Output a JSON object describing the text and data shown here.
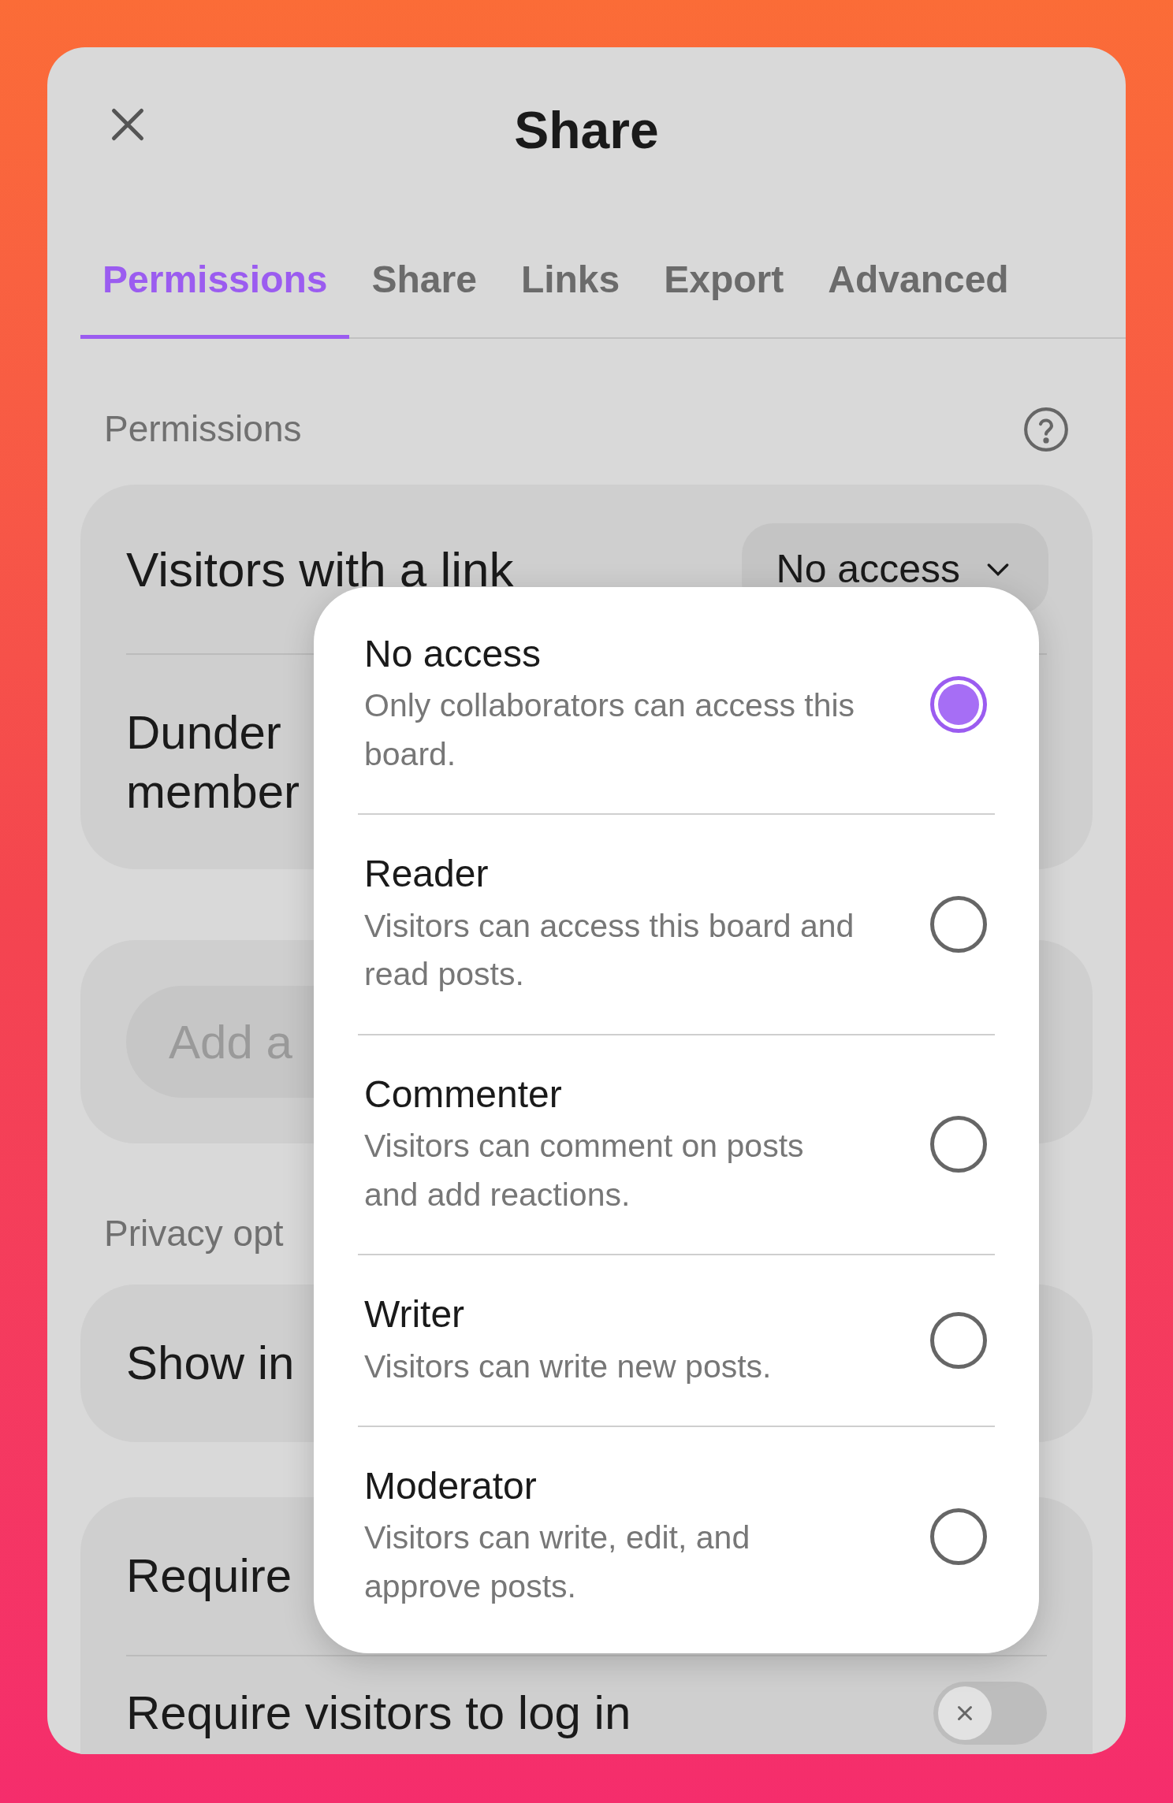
{
  "dialog": {
    "title": "Share"
  },
  "tabs": [
    {
      "label": "Permissions",
      "selected": true
    },
    {
      "label": "Share",
      "selected": false
    },
    {
      "label": "Links",
      "selected": false
    },
    {
      "label": "Export",
      "selected": false
    },
    {
      "label": "Advanced",
      "selected": false
    }
  ],
  "permissions": {
    "label": "Permissions",
    "visitors_row": {
      "label": "Visitors with a link",
      "value": "No access"
    },
    "members_row": {
      "label": "Dunder member"
    }
  },
  "add_field": {
    "placeholder": "Add a"
  },
  "privacy": {
    "label": "Privacy opt",
    "show_row": {
      "label": "Show in"
    },
    "require_row": {
      "label": "Require"
    },
    "login_row": {
      "label": "Require visitors to log in",
      "on": false
    }
  },
  "access_menu": [
    {
      "title": "No access",
      "description": "Only collaborators can access this board.",
      "selected": true
    },
    {
      "title": "Reader",
      "description": "Visitors can access this board and read posts.",
      "selected": false
    },
    {
      "title": "Commenter",
      "description": "Visitors can comment on posts and add reactions.",
      "selected": false
    },
    {
      "title": "Writer",
      "description": "Visitors can write new posts.",
      "selected": false
    },
    {
      "title": "Moderator",
      "description": "Visitors can write, edit, and approve posts.",
      "selected": false
    }
  ]
}
